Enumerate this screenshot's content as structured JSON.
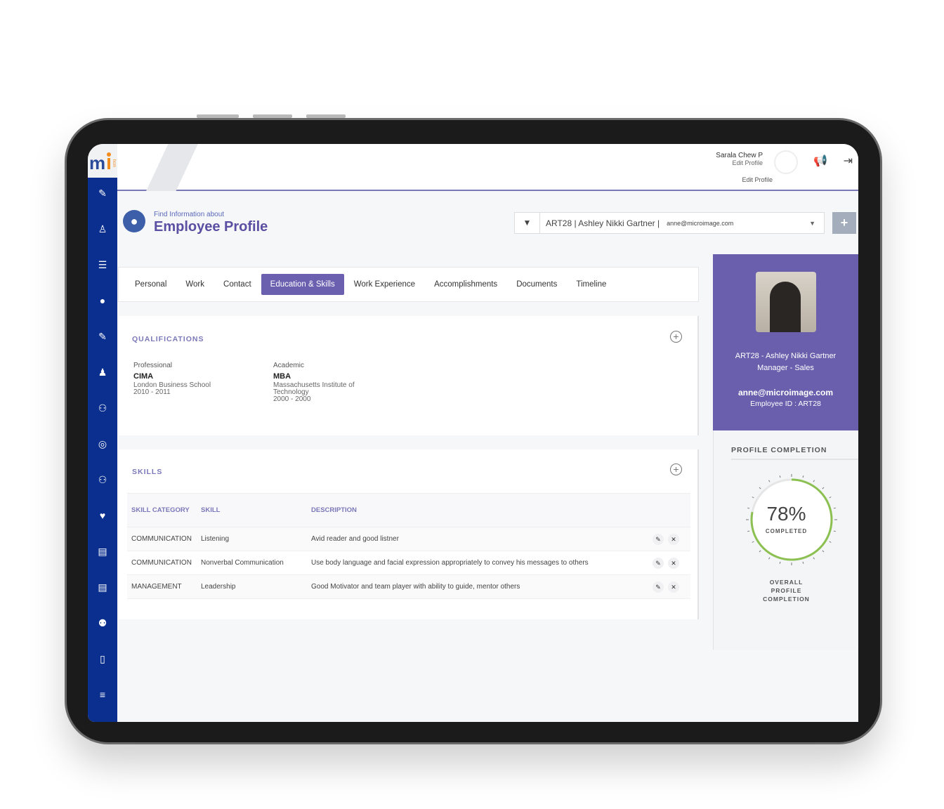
{
  "header": {
    "user_name": "Sarala Chew P",
    "edit_profile": "Edit Profile",
    "edit_profile_2": "Edit Profile"
  },
  "page": {
    "subtitle": "Find Information about",
    "title": "Employee Profile"
  },
  "search": {
    "value": "ART28 | Ashley Nikki Gartner |",
    "email": "anne@microimage.com",
    "add_label": "+"
  },
  "tabs": [
    {
      "label": "Personal"
    },
    {
      "label": "Work"
    },
    {
      "label": "Contact"
    },
    {
      "label": "Education & Skills",
      "active": true
    },
    {
      "label": "Work Experience"
    },
    {
      "label": "Accomplishments"
    },
    {
      "label": "Documents"
    },
    {
      "label": "Timeline"
    }
  ],
  "qualifications": {
    "title": "QUALIFICATIONS",
    "items": [
      {
        "type": "Professional",
        "name": "CIMA",
        "institute": "London Business School",
        "years": "2010 - 2011"
      },
      {
        "type": "Academic",
        "name": "MBA",
        "institute": "Massachusetts Institute of Technology",
        "years": "2000 - 2000"
      }
    ]
  },
  "skills": {
    "title": "SKILLS",
    "columns": [
      "SKILL CATEGORY",
      "SKILL",
      "DESCRIPTION"
    ],
    "rows": [
      [
        "COMMUNICATION",
        "Listening",
        "Avid reader and good listner"
      ],
      [
        "COMMUNICATION",
        "Nonverbal Communication",
        "Use body language and facial expression appropriately to convey his messages to others"
      ],
      [
        "MANAGEMENT",
        "Leadership",
        "Good Motivator and team player with ability to guide, mentor others"
      ]
    ]
  },
  "employee": {
    "name_line": "ART28 - Ashley Nikki Gartner",
    "role": "Manager - Sales",
    "email": "anne@microimage.com",
    "id_line": "Employee ID : ART28"
  },
  "profile_completion": {
    "title": "PROFILE COMPLETION",
    "percent": 78,
    "percent_label": "78%",
    "completed": "COMPLETED",
    "overall": "OVERALL PROFILE COMPLETION"
  },
  "colors": {
    "sidebar": "#0b2f8f",
    "accent": "#6a5fad",
    "gauge": "#8cc152"
  }
}
